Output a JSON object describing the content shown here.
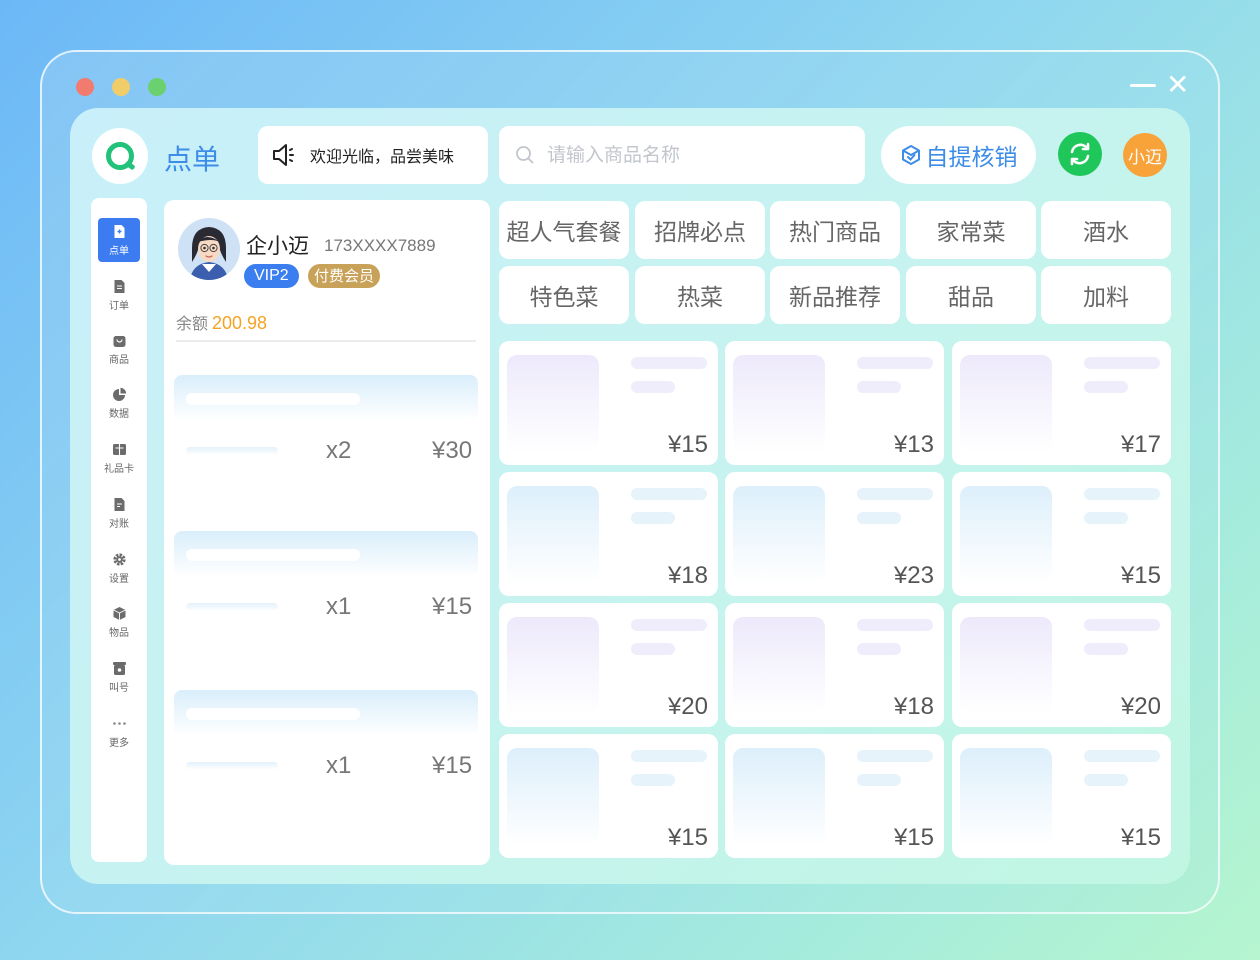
{
  "app": {
    "title": "点单"
  },
  "notice": {
    "text": "欢迎光临，品尝美味"
  },
  "search": {
    "placeholder": "请输入商品名称"
  },
  "header": {
    "pickup_label": "自提核销",
    "user_initials": "小迈"
  },
  "sidebar": {
    "items": [
      {
        "label": "点单",
        "icon": "order-doc-icon",
        "active": true
      },
      {
        "label": "订单",
        "icon": "document-icon"
      },
      {
        "label": "商品",
        "icon": "bag-icon"
      },
      {
        "label": "数据",
        "icon": "pie-chart-icon"
      },
      {
        "label": "礼品卡",
        "icon": "gift-card-icon"
      },
      {
        "label": "对账",
        "icon": "reconcile-icon"
      },
      {
        "label": "设置",
        "icon": "gear-icon"
      },
      {
        "label": "物品",
        "icon": "box-icon"
      },
      {
        "label": "叫号",
        "icon": "call-number-icon"
      },
      {
        "label": "更多",
        "icon": "more-dots-icon"
      }
    ]
  },
  "member": {
    "name": "企小迈",
    "phone": "173XXXX7889",
    "level": "VIP2",
    "member_type": "付费会员",
    "balance_label": "余额",
    "balance": "200.98"
  },
  "order_items": [
    {
      "qty": "x2",
      "price": "¥30"
    },
    {
      "qty": "x1",
      "price": "¥15"
    },
    {
      "qty": "x1",
      "price": "¥15"
    }
  ],
  "categories": [
    "超人气套餐",
    "招牌必点",
    "热门商品",
    "家常菜",
    "酒水",
    "特色菜",
    "热菜",
    "新品推荐",
    "甜品",
    "加料"
  ],
  "products": [
    {
      "price": "¥15"
    },
    {
      "price": "¥13"
    },
    {
      "price": "¥17"
    },
    {
      "price": "¥18"
    },
    {
      "price": "¥23"
    },
    {
      "price": "¥15"
    },
    {
      "price": "¥20"
    },
    {
      "price": "¥18"
    },
    {
      "price": "¥20"
    },
    {
      "price": "¥15"
    },
    {
      "price": "¥15"
    },
    {
      "price": "¥15"
    }
  ],
  "colors": {
    "accent": "#3d8ce8",
    "brand_green": "#22c27a",
    "balance_orange": "#f5a323",
    "vip_blue": "#3a7ef0",
    "paid_gold": "#c9a25a"
  }
}
